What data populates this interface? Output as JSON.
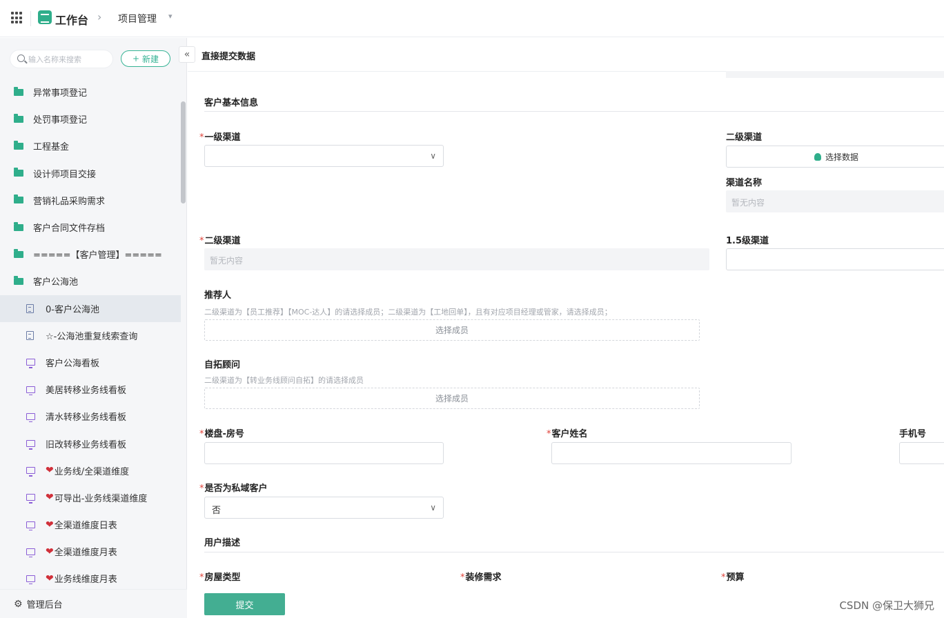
{
  "topbar": {
    "workbench": "工作台",
    "breadcrumb_arrow": "›",
    "project": "项目管理",
    "caret": "▾"
  },
  "sidebar": {
    "search_placeholder": "输入名称来搜索",
    "new_label": "新建",
    "new_plus": "+",
    "collapse": "«",
    "items": [
      {
        "label": "异常事项登记",
        "icon": "folder-icon"
      },
      {
        "label": "处罚事项登记",
        "icon": "folder-icon"
      },
      {
        "label": "工程基金",
        "icon": "folder-icon"
      },
      {
        "label": "设计师项目交接",
        "icon": "folder-icon"
      },
      {
        "label": "营销礼品采购需求",
        "icon": "folder-icon"
      },
      {
        "label": "客户合同文件存档",
        "icon": "folder-icon"
      },
      {
        "label": "=====【客户管理】=====",
        "icon": "folder-icon"
      },
      {
        "label": "客户公海池",
        "icon": "folder-icon"
      },
      {
        "label": "0-客户公海池",
        "icon": "doc-icon"
      },
      {
        "label": "☆-公海池重复线索查询",
        "icon": "doc-icon"
      },
      {
        "label": "客户公海看板",
        "icon": "board-icon"
      },
      {
        "label": "美居转移业务线看板",
        "icon": "board-icon"
      },
      {
        "label": "清水转移业务线看板",
        "icon": "board-icon"
      },
      {
        "label": "旧改转移业务线看板",
        "icon": "board-icon"
      },
      {
        "label": "业务线/全渠道维度",
        "icon": "board-icon"
      },
      {
        "label": "可导出-业务线渠道维度",
        "icon": "board-icon"
      },
      {
        "label": "全渠道维度日表",
        "icon": "board-icon"
      },
      {
        "label": "全渠道维度月表",
        "icon": "board-icon"
      },
      {
        "label": "业务线维度月表",
        "icon": "board-icon"
      }
    ],
    "heart": "❤",
    "footer_label": "管理后台",
    "gear": "⚙"
  },
  "main": {
    "page_title": "直接提交数据",
    "section_basic": "客户基本信息",
    "req_mark": "*",
    "first_channel_label": "一级渠道",
    "second_channel_label_right": "二级渠道",
    "choose_data": "选择数据",
    "channel_name_label": "渠道名称",
    "empty_text": "暂无内容",
    "second_channel_label": "二级渠道",
    "channel_1_5_label": "1.5级渠道",
    "referrer_label": "推荐人",
    "referrer_hint": "二级渠道为【员工推荐】【MOC-达人】的请选择成员；二级渠道为【工地回单】，且有对应项目经理或管家，请选择成员；",
    "choose_member": "选择成员",
    "advisor_label": "自拓顾问",
    "advisor_hint": "二级渠道为【转业务线顾问自拓】的请选择成员",
    "property_label": "楼盘-房号",
    "customer_name_label": "客户姓名",
    "phone_label": "手机号",
    "private_label": "是否为私域客户",
    "private_value": "否",
    "section_user": "用户描述",
    "house_type_label": "房屋类型",
    "decoration_label": "装修需求",
    "budget_label": "预算",
    "submit": "提交",
    "chevron": "∨"
  },
  "watermark": "CSDN @保卫大狮兄",
  "colors": {
    "brand_green": "#2fae8b",
    "submit_green": "#43ae92",
    "required_red": "#e0433a",
    "heart_red": "#d0303a",
    "board_purple": "#8a5cd6"
  }
}
